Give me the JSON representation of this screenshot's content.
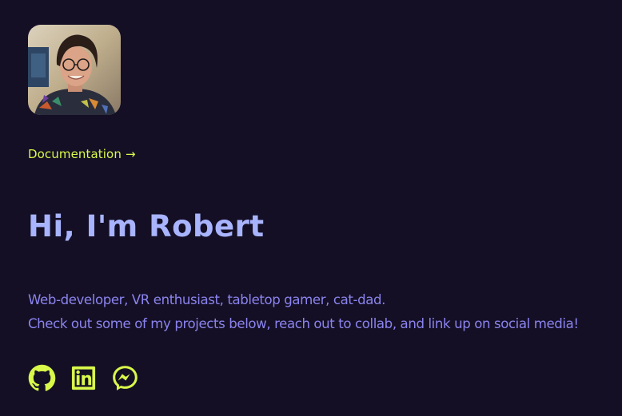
{
  "profile": {
    "avatar_icon": "portrait-photo"
  },
  "nav": {
    "documentation_label": "Documentation",
    "documentation_arrow": "→"
  },
  "hero": {
    "title": "Hi, I'm Robert",
    "line1": "Web-developer, VR enthusiast, tabletop gamer, cat-dad.",
    "line2": "Check out some of my projects below, reach out to collab, and link up on social media!"
  },
  "social": [
    {
      "icon": "github-icon"
    },
    {
      "icon": "linkedin-icon"
    },
    {
      "icon": "messenger-icon"
    }
  ],
  "colors": {
    "background": "#140f25",
    "accent": "#d8f84a",
    "title": "#a9b4ff",
    "body_text": "#8b84ee"
  }
}
